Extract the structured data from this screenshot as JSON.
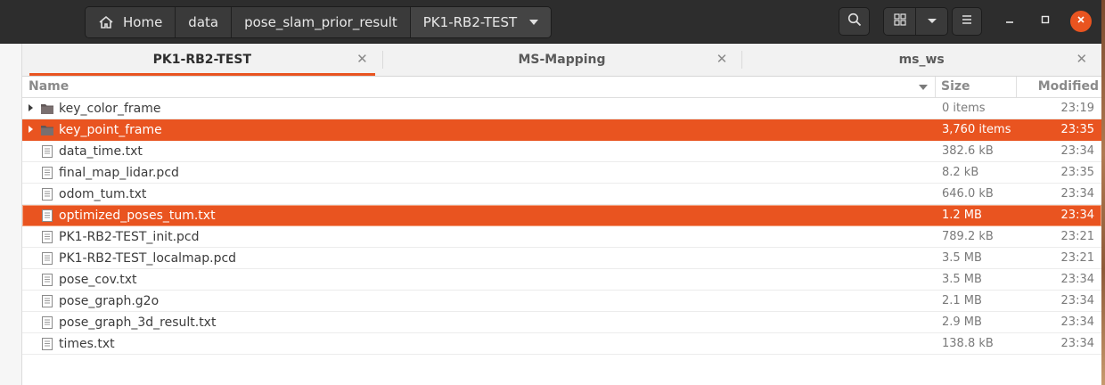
{
  "header": {
    "breadcrumbs": [
      "Home",
      "data",
      "pose_slam_prior_result",
      "PK1-RB2-TEST"
    ],
    "icons": {
      "home": "home-icon",
      "search": "search-icon",
      "view_grid": "grid-view-icon",
      "view_options": "chevron-down-icon",
      "menu": "hamburger-menu-icon",
      "minimize": "minimize-icon",
      "maximize": "maximize-icon",
      "close": "close-icon"
    },
    "accent": "#e95420"
  },
  "tabs": [
    {
      "label": "PK1-RB2-TEST",
      "active": true
    },
    {
      "label": "MS-Mapping",
      "active": false
    },
    {
      "label": "ms_ws",
      "active": false
    }
  ],
  "columns": {
    "name": "Name",
    "size": "Size",
    "modified": "Modified"
  },
  "files": [
    {
      "name": "key_color_frame",
      "size": "0 items",
      "modified": "23:19",
      "type": "folder",
      "selected": false
    },
    {
      "name": "key_point_frame",
      "size": "3,760 items",
      "modified": "23:35",
      "type": "folder",
      "selected": true
    },
    {
      "name": "data_time.txt",
      "size": "382.6 kB",
      "modified": "23:34",
      "type": "file",
      "selected": false
    },
    {
      "name": "final_map_lidar.pcd",
      "size": "8.2 kB",
      "modified": "23:35",
      "type": "file",
      "selected": false
    },
    {
      "name": "odom_tum.txt",
      "size": "646.0 kB",
      "modified": "23:34",
      "type": "file",
      "selected": false
    },
    {
      "name": "optimized_poses_tum.txt",
      "size": "1.2 MB",
      "modified": "23:34",
      "type": "file",
      "selected": true
    },
    {
      "name": "PK1-RB2-TEST_init.pcd",
      "size": "789.2 kB",
      "modified": "23:21",
      "type": "file",
      "selected": false
    },
    {
      "name": "PK1-RB2-TEST_localmap.pcd",
      "size": "3.5 MB",
      "modified": "23:21",
      "type": "file",
      "selected": false
    },
    {
      "name": "pose_cov.txt",
      "size": "3.5 MB",
      "modified": "23:34",
      "type": "file",
      "selected": false
    },
    {
      "name": "pose_graph.g2o",
      "size": "2.1 MB",
      "modified": "23:34",
      "type": "file",
      "selected": false
    },
    {
      "name": "pose_graph_3d_result.txt",
      "size": "2.9 MB",
      "modified": "23:34",
      "type": "file",
      "selected": false
    },
    {
      "name": "times.txt",
      "size": "138.8 kB",
      "modified": "23:34",
      "type": "file",
      "selected": false
    }
  ]
}
